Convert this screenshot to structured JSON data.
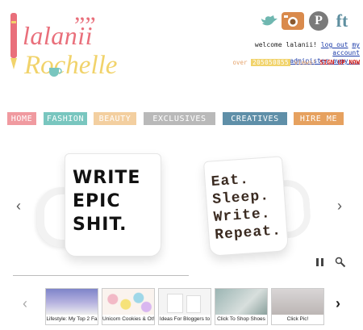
{
  "logo": {
    "line1": "lalanii",
    "line2": "Rochelle",
    "quote_mark": "””"
  },
  "header": {
    "welcome": "welcome lalanii!",
    "logout": "log out",
    "account": "my account",
    "administer": "administer away...",
    "views_prefix": "over",
    "views_count": "205050855",
    "views_suffix": "views!",
    "signup": "SIGN UP NOW"
  },
  "social": [
    {
      "icon": "twitter-bird-icon",
      "color": "#6fb7b0"
    },
    {
      "icon": "camera-icon",
      "color": "#d98a4c"
    },
    {
      "icon": "pinterest-icon",
      "color": "#7a7a7a"
    },
    {
      "icon": "facebook-tumblr-icon",
      "color": "#5f8fa0"
    }
  ],
  "nav": [
    {
      "label": "HOME",
      "color": "#f09aa0"
    },
    {
      "label": "FASHION",
      "color": "#79c6bf"
    },
    {
      "label": "BEAUTY",
      "color": "#f3cfa0"
    },
    {
      "label": "EXCLUSIVES",
      "color": "#b9b9b9"
    },
    {
      "label": "CREATIVES",
      "color": "#5f8fa8"
    },
    {
      "label": "HIRE ME",
      "color": "#e6a15f"
    }
  ],
  "slider": {
    "mug1": "WRITE\nEPIC\nSHIT.",
    "mug2": "Eat.\nSleep.\nWrite.\nRepeat.",
    "prev_arrow": "‹",
    "next_arrow": "›",
    "pause_icon": "pause-icon",
    "zoom_icon": "magnifier-icon"
  },
  "thumbnails": [
    {
      "caption": "Lifestyle: My Top 2 Fa",
      "color": "#8a8fd0"
    },
    {
      "caption": "Unicorn Cookies & Ot!",
      "color": "#f2b9c6"
    },
    {
      "caption": "Ideas For Bloggers to",
      "color": "#e9e9e9"
    },
    {
      "caption": "Click To Shop Shoes",
      "color": "#9bb5b3"
    },
    {
      "caption": "Click Pic!",
      "color": "#c9c5c4"
    }
  ],
  "carousel": {
    "prev_arrow": "‹",
    "next_arrow": "›"
  }
}
